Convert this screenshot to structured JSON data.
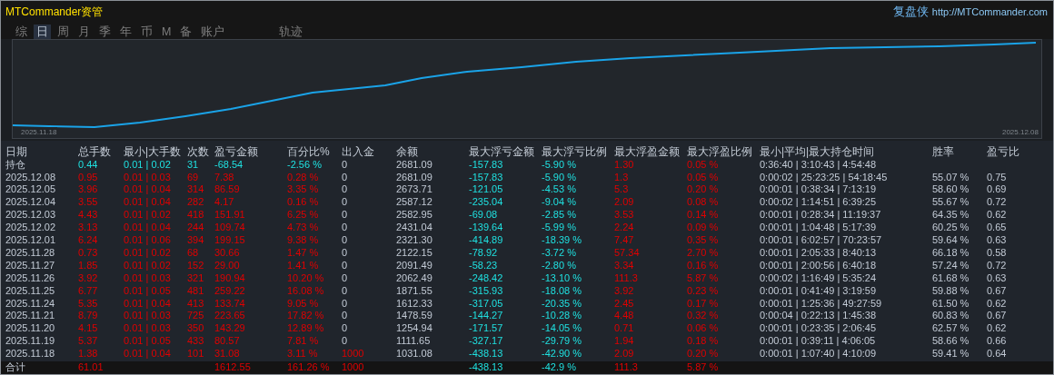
{
  "header": {
    "title": "MTCommander资管",
    "brand": "复盘侠",
    "url": "http://MTCommander.com"
  },
  "tabs": [
    {
      "label": "综",
      "selected": false
    },
    {
      "label": "日",
      "selected": true
    },
    {
      "label": "周",
      "selected": false
    },
    {
      "label": "月",
      "selected": false
    },
    {
      "label": "季",
      "selected": false
    },
    {
      "label": "年",
      "selected": false
    },
    {
      "label": "币",
      "selected": false
    },
    {
      "label": "M",
      "selected": false
    },
    {
      "label": "备",
      "selected": false
    },
    {
      "label": "账户",
      "selected": false
    },
    {
      "label": "轨迹",
      "selected": false
    }
  ],
  "equity_chart": {
    "start_label": "2025.11.18",
    "end_label": "2025.12.08"
  },
  "columns": [
    "日期",
    "总手数",
    "最小|大手数",
    "次数",
    "盈亏金额",
    "百分比%",
    "出入金",
    "余额",
    "最大浮亏金额",
    "最大浮亏比例",
    "最大浮盈金额",
    "最大浮盈比例",
    "最小|平均|最大持仓时间",
    "胜率",
    "盈亏比"
  ],
  "rows": [
    {
      "kind": "position",
      "date": "持仓",
      "lots": "0.44",
      "lot_range": "0.01 | 0.02",
      "trades": "31",
      "pnl": "-68.54",
      "pct": "-2.56 %",
      "deposit": "0",
      "balance": "2681.09",
      "max_float_loss": "-157.83",
      "max_float_loss_pct": "-5.90 %",
      "max_float_profit": "1.30",
      "max_float_profit_pct": "0.05 %",
      "hold_time": "0:36:40 | 3:10:43 | 4:54:48"
    },
    {
      "kind": "day",
      "date": "2025.12.08",
      "lots": "0.95",
      "lot_range": "0.01 | 0.03",
      "trades": "69",
      "pnl": "7.38",
      "pct": "0.28 %",
      "deposit": "0",
      "balance": "2681.09",
      "max_float_loss": "-157.83",
      "max_float_loss_pct": "-5.90 %",
      "max_float_profit": "1.3",
      "max_float_profit_pct": "0.05 %",
      "hold_time": "0:00:02 | 25:23:25 | 54:18:45",
      "win_rate": "55.07 %",
      "pl_ratio": "0.75"
    },
    {
      "kind": "day",
      "date": "2025.12.05",
      "lots": "3.96",
      "lot_range": "0.01 | 0.04",
      "trades": "314",
      "pnl": "86.59",
      "pct": "3.35 %",
      "deposit": "0",
      "balance": "2673.71",
      "max_float_loss": "-121.05",
      "max_float_loss_pct": "-4.53 %",
      "max_float_profit": "5.3",
      "max_float_profit_pct": "0.20 %",
      "hold_time": "0:00:01 | 0:38:34 | 7:13:19",
      "win_rate": "58.60 %",
      "pl_ratio": "0.69"
    },
    {
      "kind": "day",
      "date": "2025.12.04",
      "lots": "3.55",
      "lot_range": "0.01 | 0.04",
      "trades": "282",
      "pnl": "4.17",
      "pct": "0.16 %",
      "deposit": "0",
      "balance": "2587.12",
      "max_float_loss": "-235.04",
      "max_float_loss_pct": "-9.04 %",
      "max_float_profit": "2.09",
      "max_float_profit_pct": "0.08 %",
      "hold_time": "0:00:02 | 1:14:51 | 6:39:25",
      "win_rate": "55.67 %",
      "pl_ratio": "0.72"
    },
    {
      "kind": "day",
      "date": "2025.12.03",
      "lots": "4.43",
      "lot_range": "0.01 | 0.02",
      "trades": "418",
      "pnl": "151.91",
      "pct": "6.25 %",
      "deposit": "0",
      "balance": "2582.95",
      "max_float_loss": "-69.08",
      "max_float_loss_pct": "-2.85 %",
      "max_float_profit": "3.53",
      "max_float_profit_pct": "0.14 %",
      "hold_time": "0:00:01 | 0:28:34 | 11:19:37",
      "win_rate": "64.35 %",
      "pl_ratio": "0.62"
    },
    {
      "kind": "day",
      "date": "2025.12.02",
      "lots": "3.13",
      "lot_range": "0.01 | 0.04",
      "trades": "244",
      "pnl": "109.74",
      "pct": "4.73 %",
      "deposit": "0",
      "balance": "2431.04",
      "max_float_loss": "-139.64",
      "max_float_loss_pct": "-5.99 %",
      "max_float_profit": "2.24",
      "max_float_profit_pct": "0.09 %",
      "hold_time": "0:00:01 | 1:04:48 | 5:17:39",
      "win_rate": "60.25 %",
      "pl_ratio": "0.65"
    },
    {
      "kind": "day",
      "date": "2025.12.01",
      "lots": "6.24",
      "lot_range": "0.01 | 0.06",
      "trades": "394",
      "pnl": "199.15",
      "pct": "9.38 %",
      "deposit": "0",
      "balance": "2321.30",
      "max_float_loss": "-414.89",
      "max_float_loss_pct": "-18.39 %",
      "max_float_profit": "7.47",
      "max_float_profit_pct": "0.35 %",
      "hold_time": "0:00:01 | 6:02:57 | 70:23:57",
      "win_rate": "59.64 %",
      "pl_ratio": "0.63"
    },
    {
      "kind": "day",
      "date": "2025.11.28",
      "lots": "0.73",
      "lot_range": "0.01 | 0.02",
      "trades": "68",
      "pnl": "30.66",
      "pct": "1.47 %",
      "deposit": "0",
      "balance": "2122.15",
      "max_float_loss": "-78.92",
      "max_float_loss_pct": "-3.72 %",
      "max_float_profit": "57.34",
      "max_float_profit_pct": "2.70 %",
      "hold_time": "0:00:01 | 2:05:33 | 8:40:13",
      "win_rate": "66.18 %",
      "pl_ratio": "0.58"
    },
    {
      "kind": "day",
      "date": "2025.11.27",
      "lots": "1.85",
      "lot_range": "0.01 | 0.02",
      "trades": "152",
      "pnl": "29.00",
      "pct": "1.41 %",
      "deposit": "0",
      "balance": "2091.49",
      "max_float_loss": "-58.23",
      "max_float_loss_pct": "-2.80 %",
      "max_float_profit": "3.34",
      "max_float_profit_pct": "0.16 %",
      "hold_time": "0:00:01 | 2:00:56 | 6:40:18",
      "win_rate": "57.24 %",
      "pl_ratio": "0.72"
    },
    {
      "kind": "day",
      "date": "2025.11.26",
      "lots": "3.92",
      "lot_range": "0.01 | 0.03",
      "trades": "321",
      "pnl": "190.94",
      "pct": "10.20 %",
      "deposit": "0",
      "balance": "2062.49",
      "max_float_loss": "-248.42",
      "max_float_loss_pct": "-13.10 %",
      "max_float_profit": "111.3",
      "max_float_profit_pct": "5.87 %",
      "hold_time": "0:00:02 | 1:16:49 | 5:35:24",
      "win_rate": "61.68 %",
      "pl_ratio": "0.63"
    },
    {
      "kind": "day",
      "date": "2025.11.25",
      "lots": "6.77",
      "lot_range": "0.01 | 0.05",
      "trades": "481",
      "pnl": "259.22",
      "pct": "16.08 %",
      "deposit": "0",
      "balance": "1871.55",
      "max_float_loss": "-315.93",
      "max_float_loss_pct": "-18.08 %",
      "max_float_profit": "3.92",
      "max_float_profit_pct": "0.23 %",
      "hold_time": "0:00:01 | 0:41:49 | 3:19:59",
      "win_rate": "59.88 %",
      "pl_ratio": "0.67"
    },
    {
      "kind": "day",
      "date": "2025.11.24",
      "lots": "5.35",
      "lot_range": "0.01 | 0.04",
      "trades": "413",
      "pnl": "133.74",
      "pct": "9.05 %",
      "deposit": "0",
      "balance": "1612.33",
      "max_float_loss": "-317.05",
      "max_float_loss_pct": "-20.35 %",
      "max_float_profit": "2.45",
      "max_float_profit_pct": "0.17 %",
      "hold_time": "0:00:01 | 1:25:36 | 49:27:59",
      "win_rate": "61.50 %",
      "pl_ratio": "0.62"
    },
    {
      "kind": "day",
      "date": "2025.11.21",
      "lots": "8.79",
      "lot_range": "0.01 | 0.03",
      "trades": "725",
      "pnl": "223.65",
      "pct": "17.82 %",
      "deposit": "0",
      "balance": "1478.59",
      "max_float_loss": "-144.27",
      "max_float_loss_pct": "-10.28 %",
      "max_float_profit": "4.48",
      "max_float_profit_pct": "0.32 %",
      "hold_time": "0:00:04 | 0:22:13 | 1:45:38",
      "win_rate": "60.83 %",
      "pl_ratio": "0.67"
    },
    {
      "kind": "day",
      "date": "2025.11.20",
      "lots": "4.15",
      "lot_range": "0.01 | 0.03",
      "trades": "350",
      "pnl": "143.29",
      "pct": "12.89 %",
      "deposit": "0",
      "balance": "1254.94",
      "max_float_loss": "-171.57",
      "max_float_loss_pct": "-14.05 %",
      "max_float_profit": "0.71",
      "max_float_profit_pct": "0.06 %",
      "hold_time": "0:00:01 | 0:23:35 | 2:06:45",
      "win_rate": "62.57 %",
      "pl_ratio": "0.62"
    },
    {
      "kind": "day",
      "date": "2025.11.19",
      "lots": "5.37",
      "lot_range": "0.01 | 0.05",
      "trades": "433",
      "pnl": "80.57",
      "pct": "7.81 %",
      "deposit": "0",
      "balance": "1111.65",
      "max_float_loss": "-327.17",
      "max_float_loss_pct": "-29.79 %",
      "max_float_profit": "1.94",
      "max_float_profit_pct": "0.18 %",
      "hold_time": "0:00:01 | 0:39:11 | 4:06:05",
      "win_rate": "58.66 %",
      "pl_ratio": "0.66"
    },
    {
      "kind": "day",
      "date": "2025.11.18",
      "lots": "1.38",
      "lot_range": "0.01 | 0.04",
      "trades": "101",
      "pnl": "31.08",
      "pct": "3.11 %",
      "deposit": "1000",
      "balance": "1031.08",
      "max_float_loss": "-438.13",
      "max_float_loss_pct": "-42.90 %",
      "max_float_profit": "2.09",
      "max_float_profit_pct": "0.20 %",
      "hold_time": "0:00:01 | 1:07:40 | 4:10:09",
      "win_rate": "59.41 %",
      "pl_ratio": "0.64"
    },
    {
      "kind": "total",
      "date": "合计",
      "lots": "61.01",
      "pnl": "1612.55",
      "pct": "161.26 %",
      "deposit": "1000",
      "max_float_loss": "-438.13",
      "max_float_loss_pct": "-42.9 %",
      "max_float_profit": "111.3",
      "max_float_profit_pct": "5.87 %"
    }
  ]
}
